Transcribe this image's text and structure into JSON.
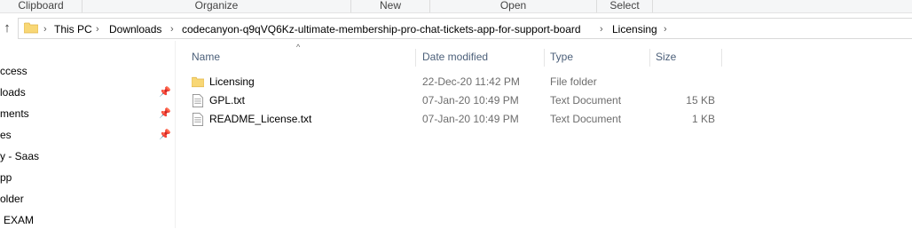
{
  "ribbon": {
    "groups": [
      "Clipboard",
      "Organize",
      "New",
      "Open",
      "Select"
    ]
  },
  "address_bar": {
    "up_icon": "up-arrow-icon",
    "folder_icon": "folder-icon",
    "crumbs": [
      "This PC",
      "Downloads",
      "codecanyon-q9qVQ6Kz-ultimate-membership-pro-chat-tickets-app-for-support-board",
      "Licensing"
    ]
  },
  "nav_pane": {
    "items": [
      "ccess",
      "loads",
      "ments",
      "es",
      "y - Saas",
      "pp",
      "older",
      "EXAM"
    ],
    "pinned": [
      false,
      true,
      true,
      true,
      false,
      false,
      false,
      false
    ]
  },
  "file_list": {
    "columns": {
      "name": "Name",
      "date": "Date modified",
      "type": "Type",
      "size": "Size"
    },
    "rows": [
      {
        "icon": "folder-icon",
        "name": "Licensing",
        "date": "22-Dec-20 11:42 PM",
        "type": "File folder",
        "size": ""
      },
      {
        "icon": "text-document-icon",
        "name": "GPL.txt",
        "date": "07-Jan-20 10:49 PM",
        "type": "Text Document",
        "size": "15 KB"
      },
      {
        "icon": "text-document-icon",
        "name": "README_License.txt",
        "date": "07-Jan-20 10:49 PM",
        "type": "Text Document",
        "size": "1 KB"
      }
    ]
  },
  "colors": {
    "folder": "#f8d775",
    "folder_dark": "#e0b54a",
    "header_text": "#4c607a",
    "meta_text": "#6d6d6d"
  }
}
